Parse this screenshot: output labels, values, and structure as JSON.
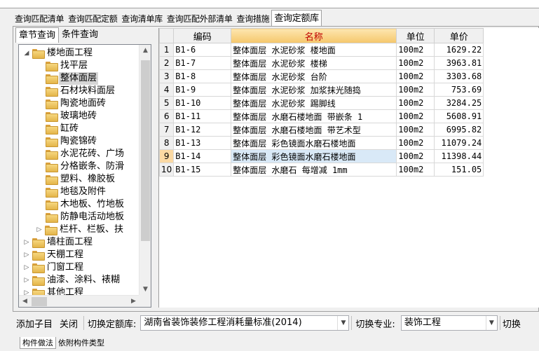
{
  "top_tabs": [
    {
      "label": "查询匹配清单",
      "active": false
    },
    {
      "label": "查询匹配定额",
      "active": false
    },
    {
      "label": "查询清单库",
      "active": false
    },
    {
      "label": "查询匹配外部清单",
      "active": false
    },
    {
      "label": "查询措施",
      "active": false
    },
    {
      "label": "查询定额库",
      "active": true
    }
  ],
  "left_tabs": [
    {
      "label": "章节查询",
      "active": true
    },
    {
      "label": "条件查询",
      "active": false
    }
  ],
  "tree": [
    {
      "label": "楼地面工程",
      "level": 0,
      "toggle": "open"
    },
    {
      "label": "找平层",
      "level": 1
    },
    {
      "label": "整体面层",
      "level": 1,
      "selected": true
    },
    {
      "label": "石材块料面层",
      "level": 1
    },
    {
      "label": "陶瓷地面砖",
      "level": 1
    },
    {
      "label": "玻璃地砖",
      "level": 1
    },
    {
      "label": "缸砖",
      "level": 1
    },
    {
      "label": "陶瓷锦砖",
      "level": 1
    },
    {
      "label": "水泥花砖、广场",
      "level": 1
    },
    {
      "label": "分格嵌条、防滑",
      "level": 1
    },
    {
      "label": "塑料、橡胶板",
      "level": 1
    },
    {
      "label": "地毯及附件",
      "level": 1
    },
    {
      "label": "木地板、竹地板",
      "level": 1
    },
    {
      "label": "防静电活动地板",
      "level": 1
    },
    {
      "label": "栏杆、栏板、扶",
      "level": 1,
      "toggle": "closed"
    },
    {
      "label": "墙柱面工程",
      "level": 0,
      "toggle": "closed"
    },
    {
      "label": "天棚工程",
      "level": 0,
      "toggle": "closed"
    },
    {
      "label": "门窗工程",
      "level": 0,
      "toggle": "closed"
    },
    {
      "label": "油漆、涂料、裱糊",
      "level": 0,
      "toggle": "closed"
    },
    {
      "label": "其他工程",
      "level": 0,
      "toggle": "closed"
    }
  ],
  "table": {
    "headers": [
      "编码",
      "名称",
      "单位",
      "单价"
    ],
    "rows": [
      {
        "n": "1",
        "code": "B1-6",
        "name": "整体面层 水泥砂浆 楼地面",
        "unit": "100m2",
        "price": "1629.22"
      },
      {
        "n": "2",
        "code": "B1-7",
        "name": "整体面层 水泥砂浆 楼梯",
        "unit": "100m2",
        "price": "3963.81"
      },
      {
        "n": "3",
        "code": "B1-8",
        "name": "整体面层 水泥砂浆 台阶",
        "unit": "100m2",
        "price": "3303.68"
      },
      {
        "n": "4",
        "code": "B1-9",
        "name": "整体面层 水泥砂浆 加浆抹光随捣",
        "unit": "100m2",
        "price": "753.69"
      },
      {
        "n": "5",
        "code": "B1-10",
        "name": "整体面层 水泥砂浆 踢脚线",
        "unit": "100m2",
        "price": "3284.25"
      },
      {
        "n": "6",
        "code": "B1-11",
        "name": "整体面层 水磨石楼地面 带嵌条 1",
        "unit": "100m2",
        "price": "5608.91"
      },
      {
        "n": "7",
        "code": "B1-12",
        "name": "整体面层 水磨石楼地面 带艺术型",
        "unit": "100m2",
        "price": "6995.82"
      },
      {
        "n": "8",
        "code": "B1-13",
        "name": "整体面层 彩色镜面水磨石楼地面",
        "unit": "100m2",
        "price": "11079.24"
      },
      {
        "n": "9",
        "code": "B1-14",
        "name": "整体面层 彩色镜面水磨石楼地面",
        "unit": "100m2",
        "price": "11398.44"
      },
      {
        "n": "10",
        "code": "B1-15",
        "name": "整体面层 水磨石 每增减 1mm",
        "unit": "100m2",
        "price": "151.05"
      }
    ],
    "current_row": 9
  },
  "bottom": {
    "add_child": "添加子目",
    "close": "关闭",
    "switch_lib_label": "切换定额库:",
    "switch_lib_value": "湖南省装饰装修工程消耗量标准(2014)",
    "switch_major_label": "切换专业:",
    "switch_major_value": "装饰工程",
    "switch_more": "切换"
  },
  "bottom_tabs": [
    "构件做法",
    "依附构件类型"
  ]
}
